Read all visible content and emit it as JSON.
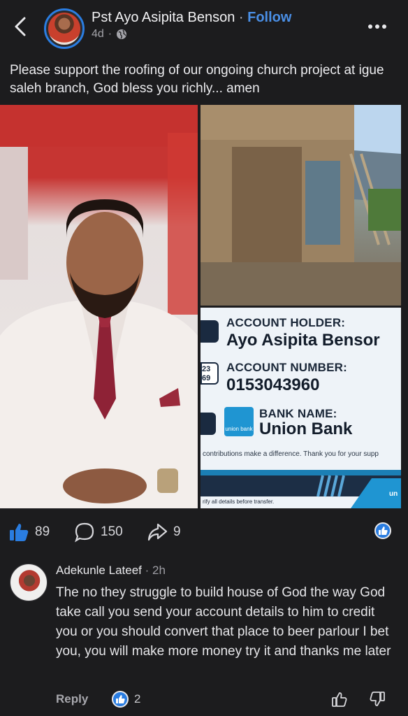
{
  "header": {
    "author": "Pst Ayo Asipita Benson",
    "separator": "·",
    "follow_label": "Follow",
    "time": "4d"
  },
  "post": {
    "text": "Please support the roofing of our ongoing church project at igue saleh branch, God bless you richly... amen"
  },
  "flyer": {
    "holder_label": "ACCOUNT HOLDER:",
    "holder_value": "Ayo Asipita Bensor",
    "number_label": "ACCOUNT NUMBER:",
    "number_value": "0153043960",
    "number_icon_text": "23\n69",
    "bank_label": "BANK NAME:",
    "bank_value": "Union Bank",
    "bank_logo_text": "union bank",
    "thanks_text": "contributions make a difference. Thank you for your supp",
    "verify_text": "rify all details before transfer.",
    "corner_text": "un"
  },
  "reactions": {
    "likes": "89",
    "comments": "150",
    "shares": "9"
  },
  "comment": {
    "name": "Adekunle Lateef",
    "time": "2h",
    "body": "The no they struggle to build house of God the way God take call you send your account details to him to credit you or you should convert that place to beer parlour I bet you, you will make more money try it and thanks me later",
    "reply_label": "Reply",
    "like_count": "2"
  },
  "colors": {
    "background": "#1c1c1e",
    "accent": "#2a7de1",
    "follow": "#4a8fe6"
  }
}
